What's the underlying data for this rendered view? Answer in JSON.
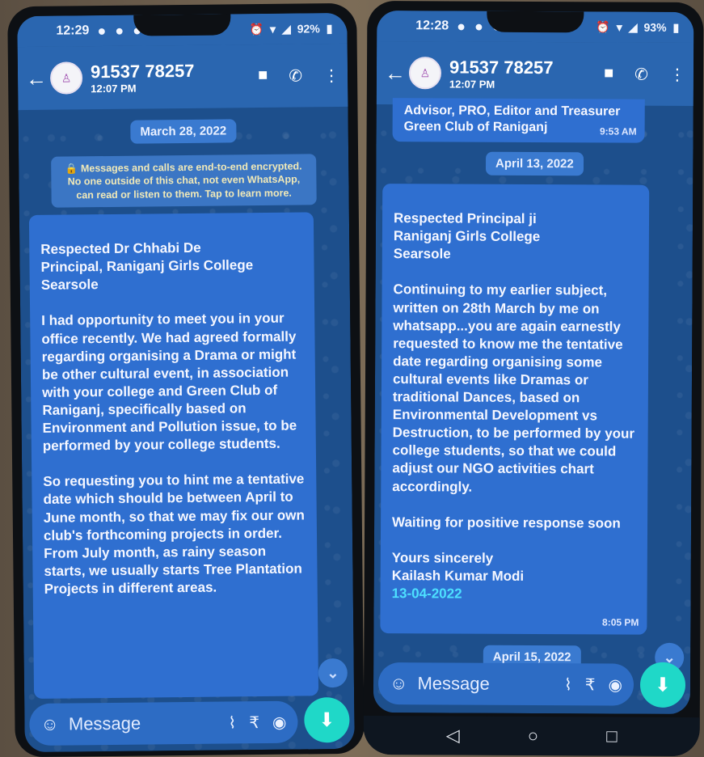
{
  "left": {
    "status": {
      "time": "12:29",
      "battery": "92%"
    },
    "header": {
      "phone": "91537 78257",
      "last_seen": "12:07 PM"
    },
    "date_chip": "March 28, 2022",
    "encryption_notice": "🔒 Messages and calls are end-to-end encrypted. No one outside of this chat, not even WhatsApp, can read or listen to them. Tap to learn more.",
    "message": "Respected Dr Chhabi De\nPrincipal, Raniganj Girls College\nSearsole\n\nI had opportunity to meet you in your office recently. We had agreed formally regarding organising a Drama or might be other cultural event, in association with your college and Green Club of Raniganj, specifically  based on Environment and Pollution issue, to be performed by your college students.\n\nSo requesting you to hint me a tentative date which should be between April to June month, so that we may fix our own club's forthcoming projects in order. From July month, as rainy season starts, we usually starts Tree Plantation Projects in different areas.",
    "input_placeholder": "Message"
  },
  "right": {
    "status": {
      "time": "12:28",
      "battery": "93%"
    },
    "header": {
      "phone": "91537 78257",
      "last_seen": "12:07 PM"
    },
    "cut_message": "Advisor, PRO, Editor and Treasurer\nGreen Club of Raniganj",
    "cut_time": "9:53 AM",
    "date_chip_1": "April 13, 2022",
    "message": "Respected Principal ji\nRaniganj Girls College\nSearsole\n\nContinuing to my earlier subject, written on 28th March by me on whatsapp...you are again earnestly requested to know me the tentative date regarding organising some cultural events like Dramas or traditional Dances, based on Environmental Development vs Destruction, to be performed by your college students, so that we could adjust our NGO activities chart accordingly.\n\nWaiting for positive response soon\n\nYours sincerely\nKailash Kumar Modi",
    "message_date": "13-04-2022",
    "message_time": "8:05 PM",
    "date_chip_2": "April 15, 2022",
    "input_placeholder": "Message"
  }
}
